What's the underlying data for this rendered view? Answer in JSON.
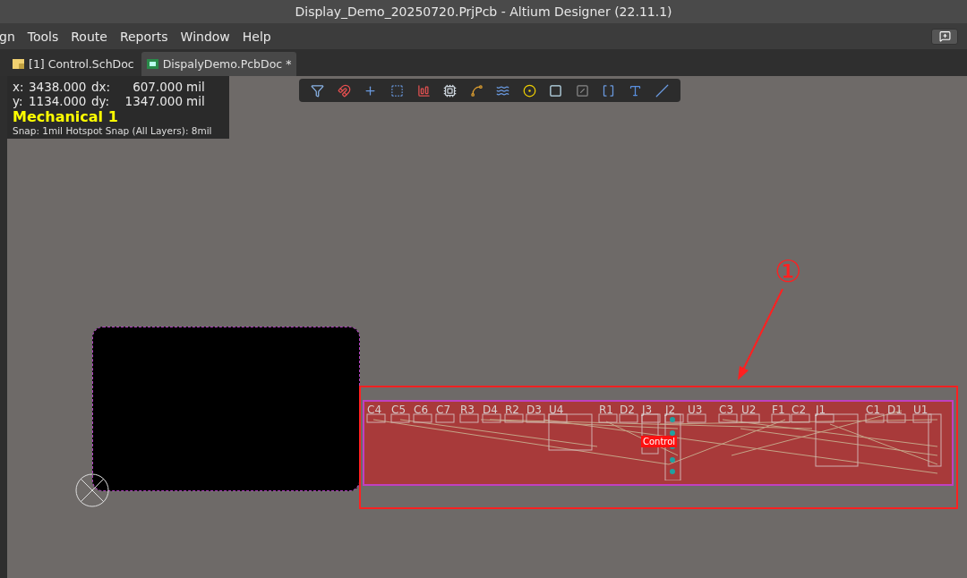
{
  "window": {
    "title": "Display_Demo_20250720.PrjPcb - Altium Designer (22.11.1)"
  },
  "menu": [
    "gn",
    "Tools",
    "Route",
    "Reports",
    "Window",
    "Help"
  ],
  "tabs": [
    {
      "label": "[1] Control.SchDoc",
      "kind": "schematic",
      "selected": false
    },
    {
      "label": "DispalyDemo.PcbDoc *",
      "kind": "pcb",
      "selected": true
    }
  ],
  "hud": {
    "rows": [
      {
        "axis": "x:",
        "value": "3438.000",
        "delta_label": "dx:",
        "delta": "607.000",
        "unit": "mil"
      },
      {
        "axis": "y:",
        "value": "1134.000",
        "delta_label": "dy:",
        "delta": "1347.000",
        "unit": "mil"
      }
    ],
    "layer": "Mechanical 1",
    "snap": "Snap: 1mil Hotspot Snap (All Layers): 8mil"
  },
  "board": {
    "designators": [
      "C4",
      "C5",
      "C6",
      "C7",
      "R3",
      "D4",
      "R2",
      "D3",
      "U4",
      "R1",
      "D2",
      "J3",
      "J2",
      "U3",
      "C3",
      "U2",
      "F1",
      "C2",
      "J1",
      "C1",
      "D1",
      "U1"
    ],
    "room_label": "Control"
  },
  "annotation": {
    "label": "①"
  }
}
